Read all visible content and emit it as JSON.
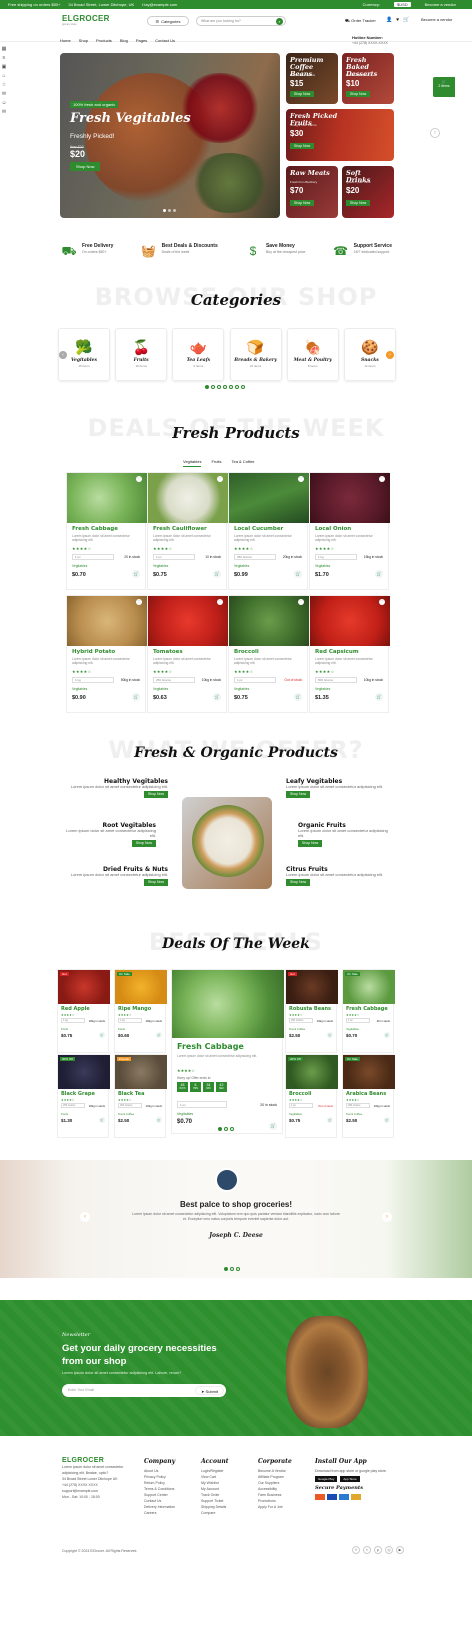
{
  "topbar": {
    "shipping": "Free shipping on orders $50+",
    "address": "34 Broad Street, Lower Ditchope, UK",
    "email": "f.lay@example.com",
    "currency_label": "Currency:",
    "currency_value": "$USD",
    "vendor": "Become a vendor"
  },
  "header": {
    "logo": "ELGROCER",
    "logo_sub": "grocery store",
    "categories_btn": "Categories",
    "search_placeholder": "What are you looking for?",
    "order_tracker": "Order Tracker",
    "hotline_label": "Hotline Number:",
    "hotline_number": "+44 (278) XXXX-XXXX",
    "nav": [
      "Home",
      "Shop",
      "Products",
      "Blog",
      "Pages",
      "Contact Us"
    ],
    "float_btn": "2 items"
  },
  "hero": {
    "tag": "100% fresh and organic",
    "title": "Fresh Vegitables",
    "subtitle": "Freshly Picked!",
    "old_price": "Was $30",
    "price": "$20",
    "button": "Shop Now"
  },
  "promos": [
    {
      "title": "Premium Coffee Beans",
      "sub": "Best Coffee Beans",
      "price": "$15",
      "btn": "Shop Now"
    },
    {
      "title": "Fresh Baked Desserts",
      "sub": "Delicious Desserts",
      "price": "$10",
      "btn": "Shop Now"
    },
    {
      "title": "Fresh Picked Fruits",
      "sub": "Straight from Farms",
      "price": "$30",
      "btn": "Shop Now"
    },
    {
      "title": "Raw Meats",
      "sub": "Fresh from Butchery",
      "price": "$70",
      "btn": "Shop Now"
    },
    {
      "title": "Soft Drinks",
      "sub": "Quench your thirst",
      "price": "$20",
      "btn": "Shop Now"
    }
  ],
  "features": [
    {
      "title": "Free Delivery",
      "sub": "On orders $50+"
    },
    {
      "title": "Best Deals & Discounts",
      "sub": "Deals of the week"
    },
    {
      "title": "Save Money",
      "sub": "Buy at the cheapest price"
    },
    {
      "title": "Support Service",
      "sub": "24/7 dedicated support"
    }
  ],
  "categories": {
    "ghost": "BROWSE OUR SHOP",
    "title": "Categories",
    "items": [
      {
        "name": "Vegitables",
        "count": "15 items"
      },
      {
        "name": "Fruits",
        "count": "18 items"
      },
      {
        "name": "Tea Leafs",
        "count": "6 items"
      },
      {
        "name": "Breads & Bakery",
        "count": "22 items"
      },
      {
        "name": "Meat & Poultry",
        "count": "8 items"
      },
      {
        "name": "Snacks",
        "count": "12 items"
      }
    ]
  },
  "fresh": {
    "ghost": "DEALS OF THE WEEK",
    "title": "Fresh Products",
    "tabs": [
      "Vegitables",
      "Fruits",
      "Tea & Coffee"
    ],
    "products": [
      {
        "name": "Fresh Cabbage",
        "qty": "1 pc",
        "stock": "20 in stock",
        "cat": "Vegitables",
        "price": "$0.70"
      },
      {
        "name": "Fresh Cauliflower",
        "qty": "1 pc",
        "stock": "10 in stock",
        "cat": "Vegitables",
        "price": "$0.75"
      },
      {
        "name": "Local Cucumber",
        "qty": "250 Grams",
        "stock": "20kg in stock",
        "cat": "Vegitables",
        "price": "$0.99"
      },
      {
        "name": "Local Onion",
        "qty": "1 kg",
        "stock": "15kg in stock",
        "cat": "Vegitables",
        "price": "$1.70"
      },
      {
        "name": "Hybrid Potato",
        "qty": "1 kg",
        "stock": "50kg in stock",
        "cat": "Vegitables",
        "price": "$0.90"
      },
      {
        "name": "Tomatoes",
        "qty": "250 Grams",
        "stock": "10kg in stock",
        "cat": "Vegitables",
        "price": "$0.63"
      },
      {
        "name": "Broccoli",
        "qty": "1 pc",
        "stock": "Out of stock",
        "cat": "Vegitables",
        "price": "$0.75"
      },
      {
        "name": "Red Capsicum",
        "qty": "500 Grams",
        "stock": "10kg in stock",
        "cat": "Vegitables",
        "price": "$1.35"
      }
    ],
    "desc": "Lorem ipsum dolor sit amet consectetur adipisicing elit."
  },
  "offer": {
    "ghost": "WHAT WE OFFER?",
    "title": "Fresh & Organic Products",
    "desc": "Lorem ipsum dolor sit amet consectetur adipisicing elit.",
    "btn": "Shop Now",
    "items": [
      "Healthy Vegitables",
      "Leafy Vegitables",
      "Root Vegitables",
      "Organic Fruits",
      "Dried Fruits & Nuts",
      "Citrus Fruits"
    ]
  },
  "deals": {
    "ghost": "BEST DEALS",
    "title": "Deals Of The Week",
    "big": {
      "name": "Fresh Cabbage",
      "desc": "Lorem ipsum dolor sit amet consectetur adipisicing elit.",
      "hurry": "Hurry up! Offer ends in:",
      "timer": [
        "48",
        "6",
        "34",
        "42"
      ],
      "timer_labels": [
        "DAYS",
        "HRS",
        "MIN",
        "SEC"
      ],
      "qty": "1 pc",
      "stock": "20 in stock",
      "cat": "Vegitables",
      "price": "$0.70"
    },
    "items": [
      {
        "name": "Red Apple",
        "badge": "Hot",
        "qty": "1 kg",
        "stock": "18kg in stock",
        "cat": "Fruits",
        "price": "$0.75"
      },
      {
        "name": "Ripe Mango",
        "badge": "On Sale",
        "qty": "1 kg",
        "stock": "18kg in stock",
        "cat": "Fruits",
        "price": "$0.60"
      },
      {
        "name": "Robusta Beans",
        "badge": "Hot",
        "qty": "250 Grams",
        "stock": "19kg in stock",
        "cat": "Tea & Coffee",
        "price": "$2.50"
      },
      {
        "name": "Fresh Cabbage",
        "badge": "On Sale",
        "qty": "1 pc",
        "stock": "20 in stock",
        "cat": "Vegitables",
        "price": "$0.70"
      },
      {
        "name": "Black Grape",
        "badge": "30% Off",
        "qty": "250 Grams",
        "stock": "18kg in stock",
        "cat": "Fruits",
        "price": "$1.30"
      },
      {
        "name": "Black Tea",
        "badge": "Popular",
        "qty": "250 Grams",
        "stock": "10kg in stock",
        "cat": "Tea & Coffee",
        "price": "$2.50"
      },
      {
        "name": "Broccoli",
        "badge": "20% Off",
        "qty": "1 pc",
        "stock": "Out of stock",
        "cat": "Vegitables",
        "price": "$0.75"
      },
      {
        "name": "Arabica Beans",
        "badge": "On Sale",
        "qty": "250 Grams",
        "stock": "10kg in stock",
        "cat": "Tea & Coffee",
        "price": "$2.50"
      }
    ]
  },
  "testimonial": {
    "title": "Best palce to shop groceries!",
    "text": "Lorem ipsum dolor sit amet consectetur adipisicing elit. Voluptatum rem quo quis pariatur veniam blanditiis explicabo, iusto cum labore et. Excepturi vero natus corporis tempore eveniet sapiente dolor aut.",
    "author": "Joseph C. Deese"
  },
  "newsletter": {
    "tag": "Newsletter",
    "title": "Get your daily grocery necessities from our shop",
    "desc": "Lorem ipsum dolor sit amet consectetur adipisicing elit. Labore, rerum?",
    "placeholder": "Enter Your Email",
    "btn": "Submit"
  },
  "footer": {
    "about": "Lorem ipsum dolor sit amet consectetur adipisicing elit. Beatae, optio?",
    "address": "34 Broad Street Lower Ditchope UK",
    "phone": "+44 (278) XXXX-XXXX",
    "email": "support@example.com",
    "hours": "Mon - Sat: 10:00 - 18:00",
    "cols": [
      {
        "title": "Company",
        "links": [
          "About Us",
          "Privacy Policy",
          "Return Policy",
          "Terms & Conditions",
          "Support Center",
          "Contact Us",
          "Delivery Information",
          "Careers"
        ]
      },
      {
        "title": "Account",
        "links": [
          "Login/Register",
          "View Cart",
          "My Wishlist",
          "My Account",
          "Track Order",
          "Support Ticket",
          "Shipping Details",
          "Compare"
        ]
      },
      {
        "title": "Corporate",
        "links": [
          "Become A Vendor",
          "Affiliate Program",
          "Our Suppliers",
          "Accessibility",
          "Farm Business",
          "Promotions",
          "Apply For A Job"
        ]
      }
    ],
    "app_title": "Install Our App",
    "app_desc": "Download from app store or google play store.",
    "store1": "Google Play",
    "store2": "App Store",
    "pay_title": "Secure Payments",
    "copyright": "Copyright © 2024 ElGrocer. All Rights Reserved."
  },
  "colors": {
    "brand": "#2e8b2e",
    "accent": "#f39a26",
    "hot": "#d22222"
  }
}
